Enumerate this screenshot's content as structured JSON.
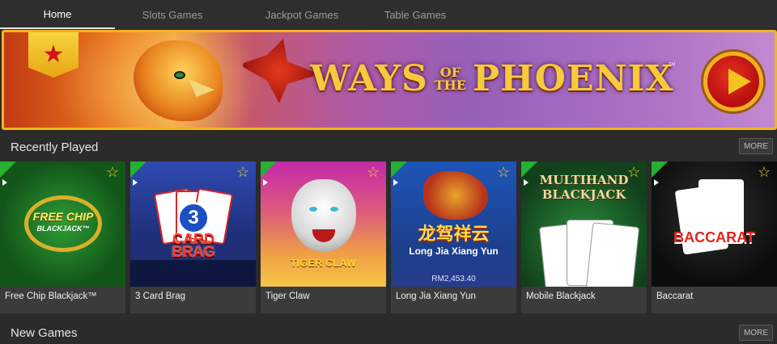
{
  "nav": {
    "tabs": [
      {
        "label": "Home",
        "active": true
      },
      {
        "label": "Slots Games",
        "active": false
      },
      {
        "label": "Jackpot Games",
        "active": false
      },
      {
        "label": "Table Games",
        "active": false
      }
    ]
  },
  "banner": {
    "title_part1": "WAYS",
    "title_of": "OF",
    "title_the": "THE",
    "title_part2": "PHOENIX",
    "trademark": "™",
    "slide_count": 3,
    "active_slide": 3
  },
  "recently_played": {
    "title": "Recently Played",
    "more_label": "MORE",
    "games": [
      {
        "name": "Free Chip Blackjack™",
        "art_text": "FREE CHIP",
        "art_sub": "BLACKJACK™"
      },
      {
        "name": "3 Card Brag",
        "art_num": "3",
        "art_text": "CARD BRAG"
      },
      {
        "name": "Tiger Claw",
        "art_text": "TIGER CLAW"
      },
      {
        "name": "Long Jia Xiang Yun",
        "art_cn": "龙驾祥云",
        "art_text": "Long Jia Xiang Yun",
        "jackpot": "RM2,453.40"
      },
      {
        "name": "Mobile Blackjack",
        "art_text": "MULTIHAND BLACKJACK"
      },
      {
        "name": "Baccarat",
        "art_text": "BACCARAT"
      }
    ]
  },
  "new_games": {
    "title": "New Games",
    "more_label": "MORE"
  },
  "colors": {
    "accent_gold": "#f0b51e",
    "play_corner_green": "#27b032",
    "favorite_star": "#f1d52d"
  },
  "icons": [
    "star-badge-icon",
    "play-icon",
    "favorite-star-icon",
    "corner-play-icon"
  ]
}
